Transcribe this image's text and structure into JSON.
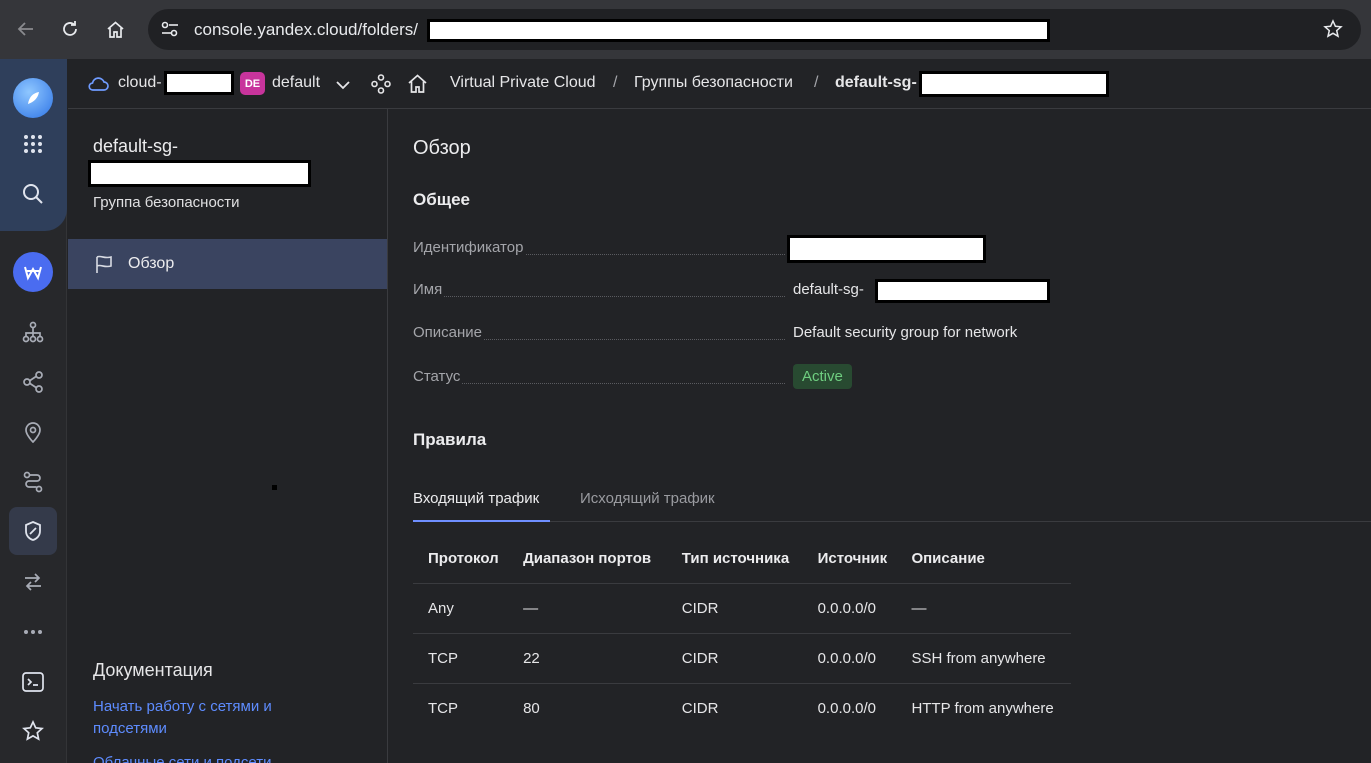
{
  "browser": {
    "url_prefix": "console.yandex.cloud/folders/"
  },
  "header": {
    "cloud_label": "cloud-",
    "folder_badge": "DE",
    "folder_name": "default",
    "breadcrumb": {
      "service": "Virtual Private Cloud",
      "separator": "/",
      "section": "Группы безопасности",
      "current": "default-sg-"
    }
  },
  "sidebar": {
    "title": "default-sg-",
    "subtitle": "Группа безопасности",
    "items": [
      {
        "label": "Обзор",
        "icon": "flag-icon",
        "active": true
      }
    ],
    "docs": {
      "title": "Документация",
      "links": [
        "Начать работу с сетями и подсетями",
        "Облачные сети и подсети"
      ]
    }
  },
  "main": {
    "heading": "Обзор",
    "general": {
      "title": "Общее",
      "rows": [
        {
          "label": "Идентификатор",
          "value": ""
        },
        {
          "label": "Имя",
          "value": "default-sg-"
        },
        {
          "label": "Описание",
          "value": "Default security group for network"
        },
        {
          "label": "Статус",
          "value": "Active"
        }
      ]
    },
    "rules": {
      "title": "Правила",
      "tabs": [
        "Входящий трафик",
        "Исходящий трафик"
      ],
      "active_tab": 0,
      "columns": [
        "Протокол",
        "Диапазон портов",
        "Тип источника",
        "Источник",
        "Описание"
      ],
      "rows": [
        [
          "Any",
          "—",
          "CIDR",
          "0.0.0.0/0",
          "—"
        ],
        [
          "TCP",
          "22",
          "CIDR",
          "0.0.0.0/0",
          "SSH from anywhere"
        ],
        [
          "TCP",
          "80",
          "CIDR",
          "0.0.0.0/0",
          "HTTP from anywhere"
        ]
      ]
    }
  },
  "colors": {
    "accent": "#5e8cff",
    "status_active_bg": "#284a31",
    "status_active_text": "#6fce80",
    "folder_badge": "#c8349c"
  }
}
